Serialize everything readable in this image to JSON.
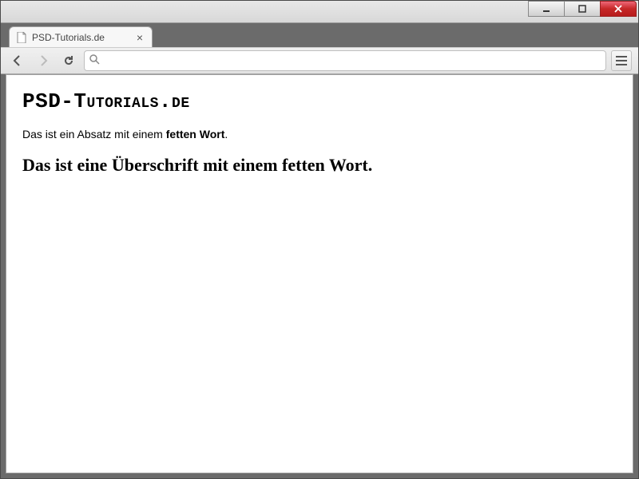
{
  "tab": {
    "title": "PSD-Tutorials.de"
  },
  "omnibox": {
    "value": ""
  },
  "content": {
    "heading_logo": "PSD-Tutorials.de",
    "paragraph_before": "Das ist ein Absatz mit einem ",
    "paragraph_bold": "fetten Wort",
    "paragraph_after": ".",
    "h2": "Das ist eine Überschrift mit einem fetten Wort."
  }
}
